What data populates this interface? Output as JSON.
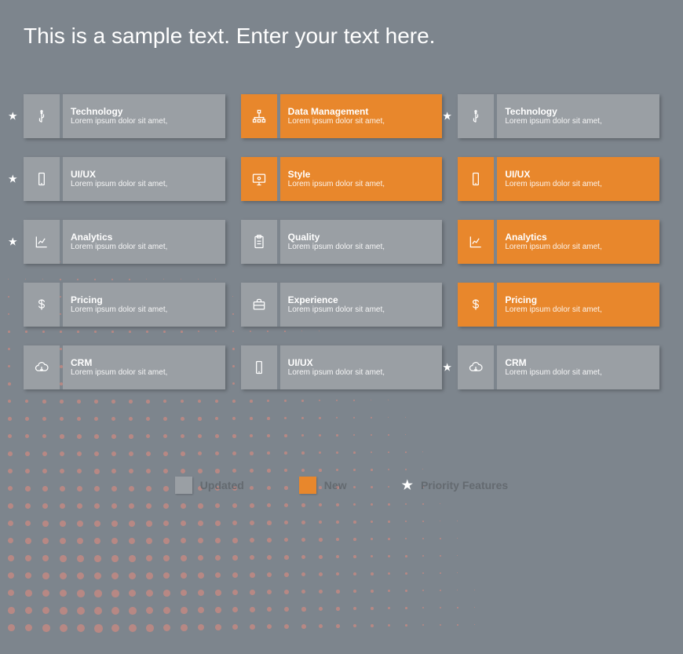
{
  "title": "This is a sample text. Enter your text here.",
  "colors": {
    "grey": "#9a9fa4",
    "orange": "#e8872c",
    "bg": "#7d858d"
  },
  "legend": {
    "updated": "Updated",
    "new": "New",
    "priority": "Priority Features"
  },
  "grid": [
    [
      {
        "star": true,
        "icon": "usb",
        "title": "Technology",
        "sub": "Lorem ipsum dolor sit amet,",
        "variant": "grey"
      },
      {
        "star": false,
        "icon": "hierarchy",
        "title": "Data Management",
        "sub": "Lorem ipsum dolor sit amet,",
        "variant": "orange"
      },
      {
        "star": true,
        "icon": "usb",
        "title": "Technology",
        "sub": "Lorem ipsum dolor sit amet,",
        "variant": "grey"
      }
    ],
    [
      {
        "star": true,
        "icon": "phone",
        "title": "UI/UX",
        "sub": "Lorem ipsum dolor sit amet,",
        "variant": "grey"
      },
      {
        "star": false,
        "icon": "monitor",
        "title": "Style",
        "sub": "Lorem ipsum dolor sit amet,",
        "variant": "orange"
      },
      {
        "star": false,
        "icon": "phone",
        "title": "UI/UX",
        "sub": "Lorem ipsum dolor sit amet,",
        "variant": "orange"
      }
    ],
    [
      {
        "star": true,
        "icon": "chart",
        "title": "Analytics",
        "sub": "Lorem ipsum dolor sit amet,",
        "variant": "grey"
      },
      {
        "star": false,
        "icon": "clipboard",
        "title": "Quality",
        "sub": "Lorem ipsum dolor sit amet,",
        "variant": "grey"
      },
      {
        "star": false,
        "icon": "chart",
        "title": "Analytics",
        "sub": "Lorem ipsum dolor sit amet,",
        "variant": "orange"
      }
    ],
    [
      {
        "star": false,
        "icon": "dollar",
        "title": "Pricing",
        "sub": "Lorem ipsum dolor sit amet,",
        "variant": "grey"
      },
      {
        "star": false,
        "icon": "briefcase",
        "title": "Experience",
        "sub": "Lorem ipsum dolor sit amet,",
        "variant": "grey"
      },
      {
        "star": false,
        "icon": "dollar",
        "title": "Pricing",
        "sub": "Lorem ipsum dolor sit amet,",
        "variant": "orange"
      }
    ],
    [
      {
        "star": false,
        "icon": "cloud",
        "title": "CRM",
        "sub": "Lorem ipsum dolor sit amet,",
        "variant": "grey"
      },
      {
        "star": false,
        "icon": "phone",
        "title": "UI/UX",
        "sub": "Lorem ipsum dolor sit amet,",
        "variant": "grey"
      },
      {
        "star": true,
        "icon": "cloud",
        "title": "CRM",
        "sub": "Lorem ipsum dolor sit amet,",
        "variant": "grey"
      }
    ]
  ]
}
